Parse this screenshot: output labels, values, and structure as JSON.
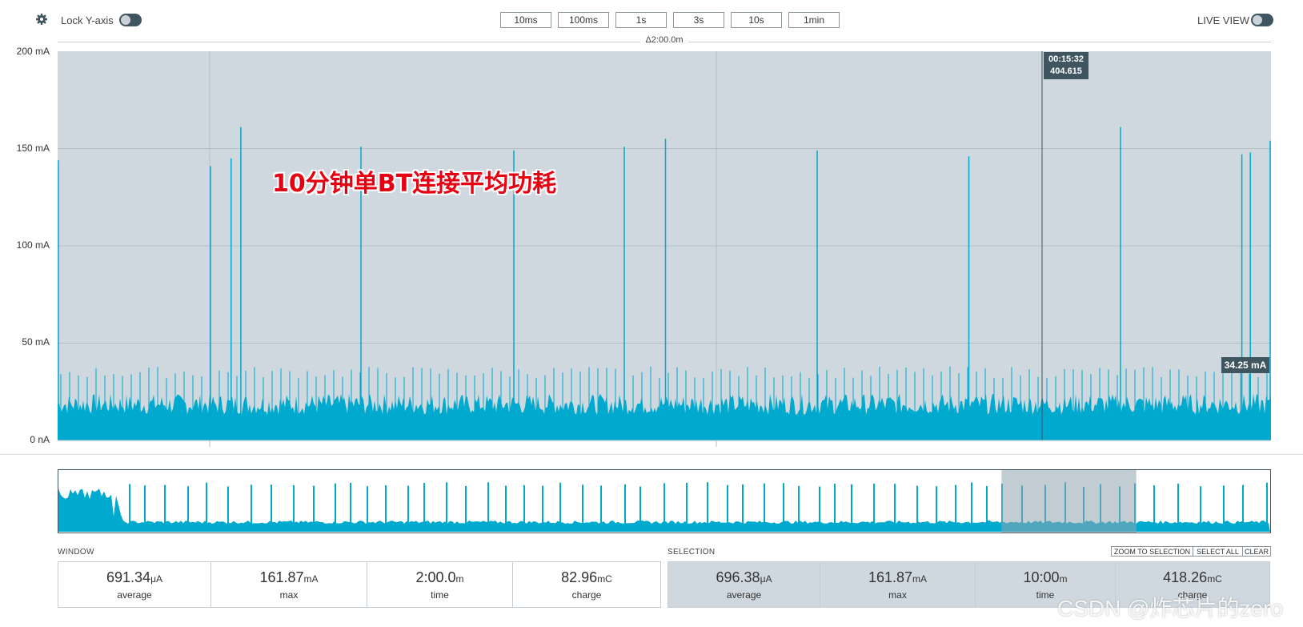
{
  "toolbar": {
    "lock_label": "Lock Y-axis",
    "lock_on": false,
    "timescale_buttons": [
      "10ms",
      "100ms",
      "1s",
      "3s",
      "10s",
      "1min"
    ],
    "live_label": "LIVE VIEW",
    "live_on": false
  },
  "chart": {
    "span_label": "Δ2:00.0m",
    "y_ticks": [
      "200 mA",
      "150 mA",
      "100 mA",
      "50 mA",
      "0 nA"
    ],
    "annotation": "10分钟单BT连接平均功耗",
    "cursor_time": "00:15:32",
    "cursor_value": "404.615",
    "marker_value": "34.25 mA",
    "background_color": "#ced8de",
    "trace_color": "#00a9ce"
  },
  "chart_data": {
    "type": "line",
    "ylabel": "",
    "ylim": [
      0,
      200
    ],
    "y_unit": "mA",
    "baseline_ma": [
      0,
      24
    ],
    "spikes_ma": [
      {
        "x_frac": 0.0,
        "value": 144
      },
      {
        "x_frac": 0.126,
        "value": 141
      },
      {
        "x_frac": 0.143,
        "value": 145
      },
      {
        "x_frac": 0.151,
        "value": 161
      },
      {
        "x_frac": 0.25,
        "value": 151
      },
      {
        "x_frac": 0.376,
        "value": 149
      },
      {
        "x_frac": 0.467,
        "value": 151
      },
      {
        "x_frac": 0.501,
        "value": 155
      },
      {
        "x_frac": 0.626,
        "value": 149
      },
      {
        "x_frac": 0.751,
        "value": 146
      },
      {
        "x_frac": 0.876,
        "value": 161
      },
      {
        "x_frac": 0.976,
        "value": 147
      },
      {
        "x_frac": 0.983,
        "value": 148
      },
      {
        "x_frac": 1.0,
        "value": 154
      }
    ]
  },
  "overview": {
    "selection_start_frac": 0.778,
    "selection_end_frac": 0.889
  },
  "window": {
    "label": "WINDOW",
    "average": {
      "value": "691.34",
      "unit": "μA",
      "label": "average"
    },
    "max": {
      "value": "161.87",
      "unit": "mA",
      "label": "max"
    },
    "time": {
      "value": "2:00.0",
      "unit": "m",
      "label": "time"
    },
    "charge": {
      "value": "82.96",
      "unit": "mC",
      "label": "charge"
    }
  },
  "selection": {
    "label": "SELECTION",
    "zoom_label": "ZOOM TO SELECTION",
    "select_all_label": "SELECT ALL",
    "clear_label": "CLEAR",
    "average": {
      "value": "696.38",
      "unit": "μA",
      "label": "average"
    },
    "max": {
      "value": "161.87",
      "unit": "mA",
      "label": "max"
    },
    "time": {
      "value": "10:00",
      "unit": "m",
      "label": "time"
    },
    "charge": {
      "value": "418.26",
      "unit": "mC",
      "label": "charge"
    }
  },
  "watermark": "CSDN @炸芯片的zero"
}
